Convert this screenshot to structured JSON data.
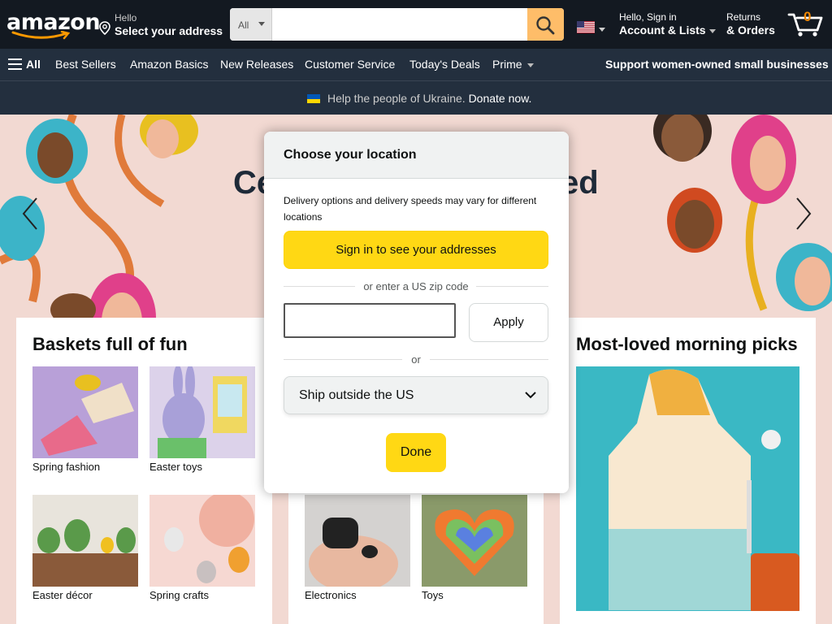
{
  "header": {
    "logo_text": "amazon",
    "address": {
      "hello": "Hello",
      "select": "Select your address"
    },
    "search": {
      "category": "All",
      "placeholder": ""
    },
    "account": {
      "line1": "Hello, Sign in",
      "line2": "Account & Lists"
    },
    "returns": {
      "line1": "Returns",
      "line2": "& Orders"
    },
    "cart": {
      "count": "0"
    },
    "colors": {
      "nav_bg": "#131921",
      "subnav_bg": "#232f3e",
      "search_button": "#febd69",
      "cart_count": "#f08804"
    },
    "icons": {
      "pin": "location-pin-icon",
      "search": "search-icon",
      "flag": "us-flag-icon",
      "cart": "cart-icon"
    }
  },
  "subnav": {
    "all": "All",
    "items": [
      "Best Sellers",
      "Amazon Basics",
      "New Releases",
      "Customer Service",
      "Today's Deals",
      "Prime"
    ],
    "promo": "Support women-owned small businesses"
  },
  "banner": {
    "text": "Help the people of Ukraine.",
    "link": "Donate now."
  },
  "hero": {
    "title_left": "Ce",
    "title_right": "ed"
  },
  "cards": [
    {
      "title": "Baskets full of fun",
      "tiles": [
        "Spring fashion",
        "Easter toys",
        "Easter décor",
        "Spring crafts"
      ]
    },
    {
      "title": "",
      "tiles": [
        "Electronics",
        "Toys"
      ]
    },
    {
      "title": "Most-loved morning picks"
    }
  ],
  "modal": {
    "title": "Choose your location",
    "description": "Delivery options and delivery speeds may vary for different locations",
    "signin_button": "Sign in to see your addresses",
    "zip_divider": "or enter a US zip code",
    "zip_value": "",
    "apply_button": "Apply",
    "or_divider": "or",
    "ship_select": "Ship outside the US",
    "done_button": "Done",
    "colors": {
      "primary_button": "#ffd814"
    }
  }
}
